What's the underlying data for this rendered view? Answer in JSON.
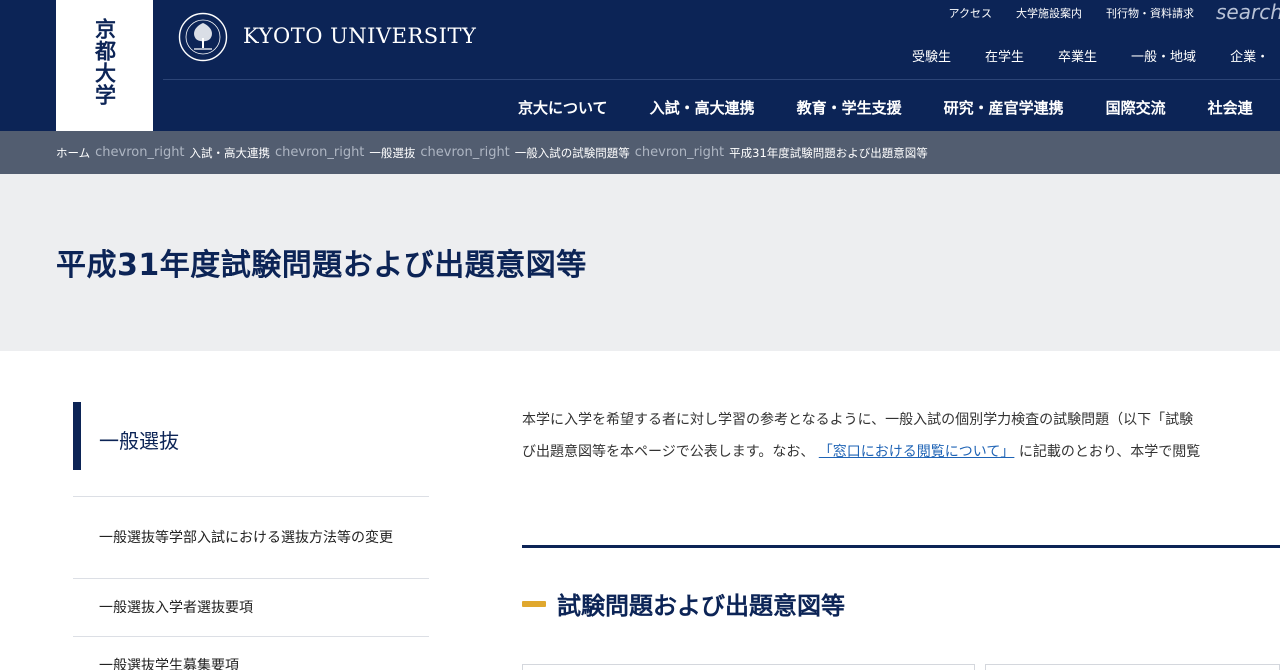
{
  "header": {
    "logo_text": "京都大学",
    "brand": "KYOTO UNIVERSITY",
    "utility_links": [
      "アクセス",
      "大学施設案内",
      "刊行物・資料請求"
    ],
    "search_label": "search",
    "audience_links": [
      "受験生",
      "在学生",
      "卒業生",
      "一般・地域",
      "企業・"
    ],
    "main_nav": [
      "京大について",
      "入試・高大連携",
      "教育・学生支援",
      "研究・産官学連携",
      "国際交流",
      "社会連"
    ]
  },
  "breadcrumb": {
    "items": [
      "ホーム",
      "入試・高大連携",
      "一般選抜",
      "一般入試の試験問題等"
    ],
    "separator": "chevron_right",
    "current": "平成31年度試験問題および出題意図等"
  },
  "page_title": "平成31年度試験問題および出題意図等",
  "sidebar": {
    "heading": "一般選抜",
    "items": [
      {
        "label": "一般選抜等学部入試における選抜方法等の変更"
      },
      {
        "label": "一般選抜入学者選抜要項"
      },
      {
        "label": "一般選抜学生募集要項"
      }
    ]
  },
  "main": {
    "intro_line1": "本学に入学を希望する者に対し学習の参考となるように、一般入試の個別学力検査の試験問題（以下「試験",
    "intro_line2_before": "び出題意図等を本ページで公表します。なお、",
    "intro_link": "「窓口における閲覧について」",
    "intro_line2_after": "に記載のとおり、本学で閲覧",
    "section_heading": "試験問題および出題意図等"
  },
  "colors": {
    "navy": "#0c2456",
    "breadcrumb_bg": "#525d70",
    "title_band_bg": "#edeef0",
    "accent": "#e0a82e",
    "link": "#1e63b5"
  }
}
